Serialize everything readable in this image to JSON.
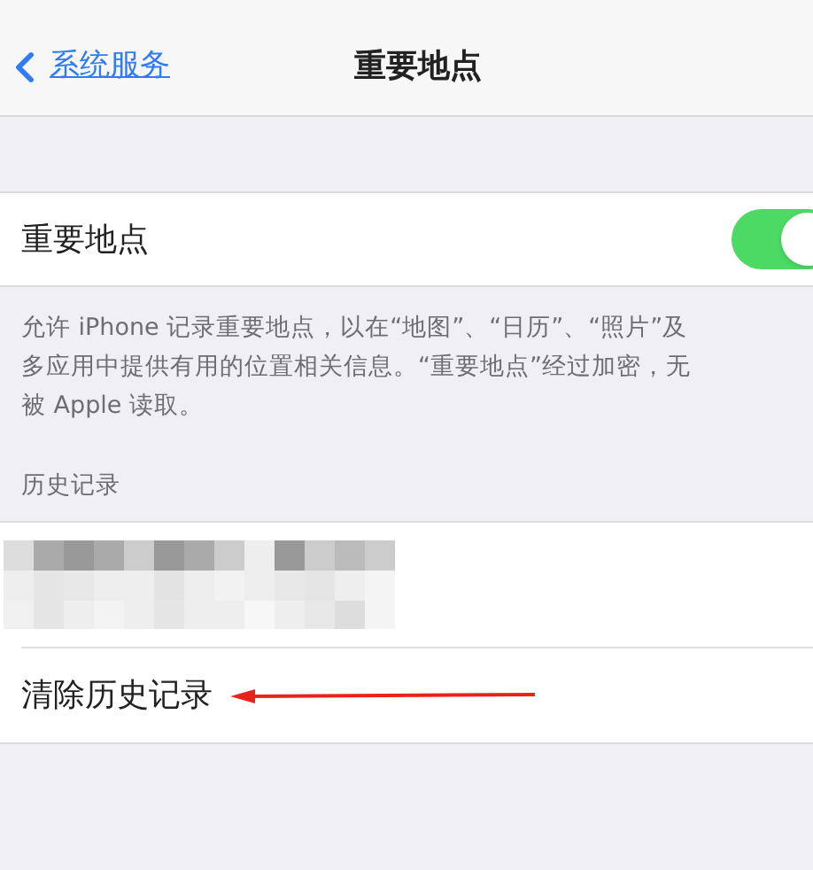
{
  "nav": {
    "back_label": "系统服务",
    "title": "重要地点"
  },
  "toggle_row": {
    "label": "重要地点",
    "on": true
  },
  "description": [
    "允许 iPhone 记录重要地点，以在“地图”、“日历”、“照片”及",
    "多应用中提供有用的位置相关信息。“重要地点”经过加密，无",
    "被 Apple 读取。"
  ],
  "history": {
    "header": "历史记录",
    "clear_label": "清除历史记录"
  }
}
